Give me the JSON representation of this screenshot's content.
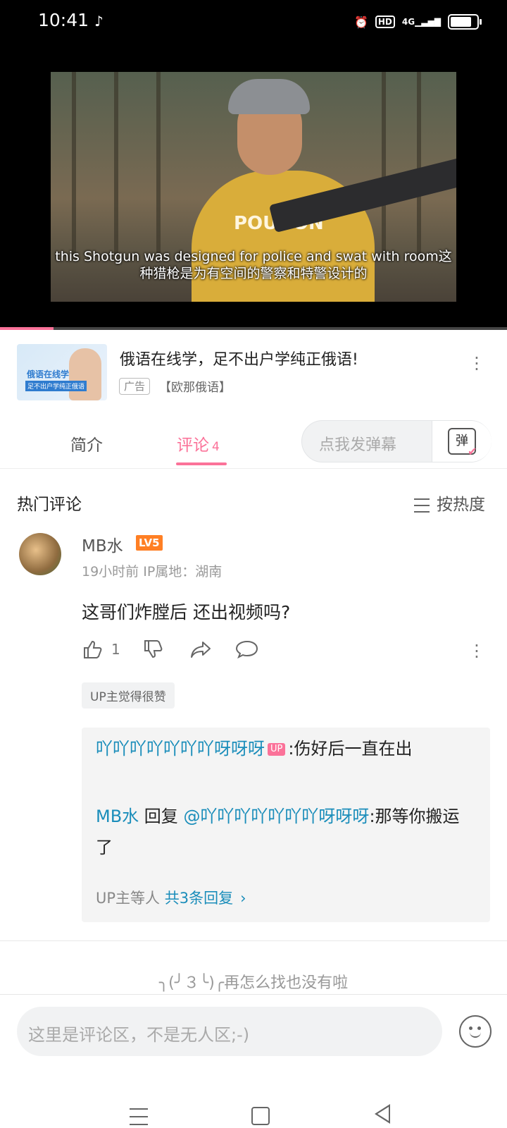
{
  "status_bar": {
    "time": "10:41",
    "network_label": "HD",
    "signal_label": "4G",
    "battery_level": 0.8
  },
  "video": {
    "subtitle_line1": "this Shotgun was designed for police and swat with room这",
    "subtitle_line2": "种猎枪是为有空间的警察和特警设计的",
    "shirt_text": "POUDON",
    "progress": 0.105
  },
  "ad": {
    "title": "俄语在线学，足不出户学纯正俄语!",
    "badge": "广告",
    "source": "【欧那俄语】",
    "thumb_text": "俄语在线学",
    "thumb_subtext": "足不出户学纯正俄语"
  },
  "tabs": {
    "intro": "简介",
    "comments": "评论",
    "comments_count": "4",
    "danmaku_placeholder": "点我发弹幕",
    "danmaku_icon": "弹"
  },
  "comments_section": {
    "title": "热门评论",
    "sort_label": "按热度"
  },
  "comment": {
    "username": "MB水",
    "level": "LV5",
    "meta": "19小时前  IP属地：湖南",
    "text": "这哥们炸膛后 还出视频吗?",
    "like_count": "1",
    "up_liked": "UP主觉得很赞"
  },
  "replies": [
    {
      "name": "吖吖吖吖吖吖吖呀呀呀",
      "badge": "UP",
      "text": ":伤好后一直在出"
    },
    {
      "name": "MB水",
      "reply_word": " 回复 ",
      "mention": "@吖吖吖吖吖吖吖呀呀呀",
      "text": ":那等你搬运了"
    }
  ],
  "reply_summary": {
    "prefix": "UP主等人 ",
    "link": "共3条回复"
  },
  "end_text": "╮(╯３╰)╭再怎么找也没有啦",
  "comment_input": {
    "placeholder": "这里是评论区，不是无人区;-)"
  },
  "icons": {
    "status": [
      "tiktok-icon",
      "alarm-icon",
      "hd-icon",
      "signal-icon",
      "battery-icon"
    ],
    "actions": [
      "thumb-up-icon",
      "thumb-down-icon",
      "share-icon",
      "comment-icon",
      "more-icon"
    ],
    "nav": [
      "menu-icon",
      "home-icon",
      "back-icon"
    ]
  },
  "colors": {
    "accent": "#fb7299",
    "link": "#1a8dba",
    "level_badge": "#ff7f24"
  }
}
